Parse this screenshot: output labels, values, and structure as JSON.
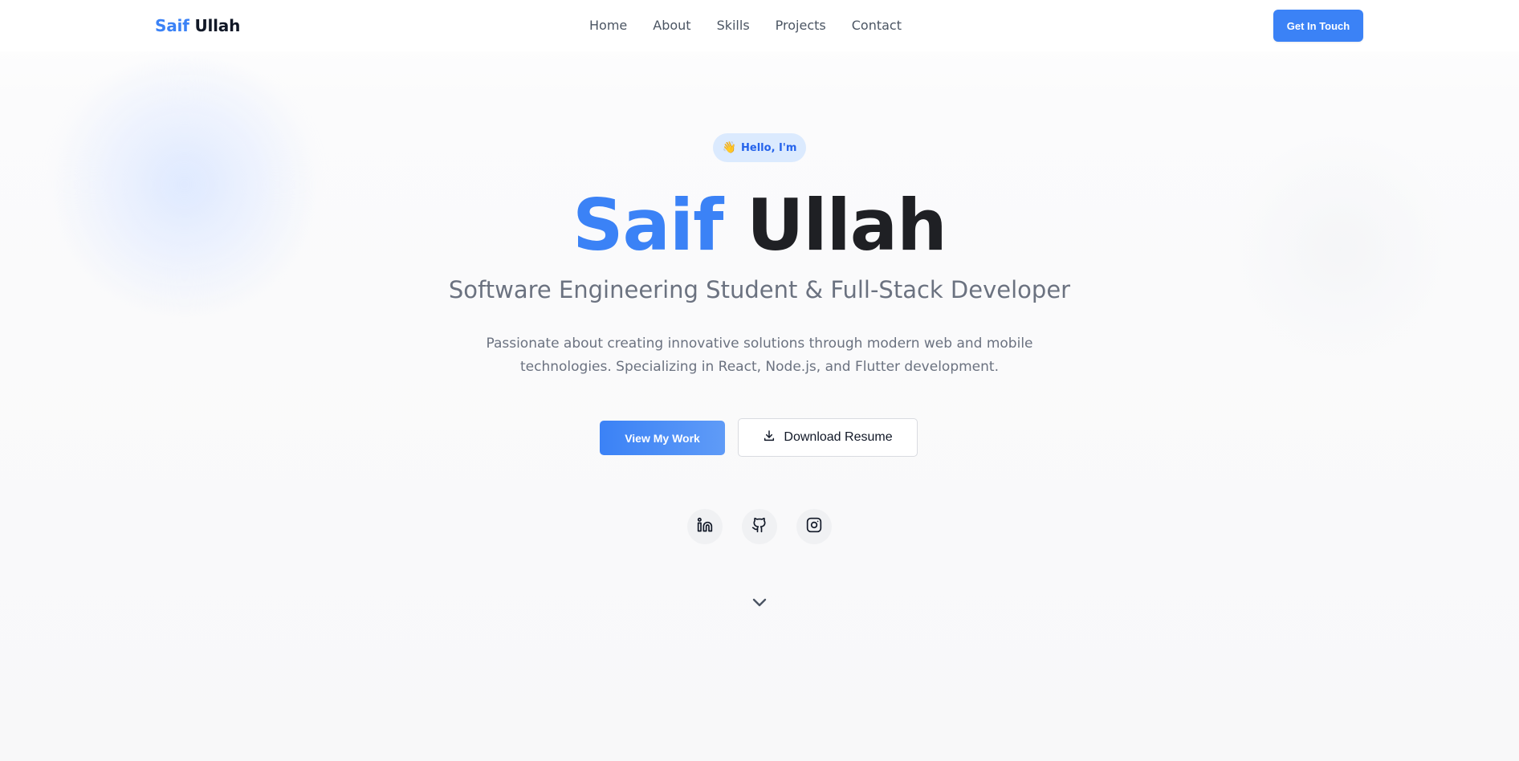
{
  "nav": {
    "brand_first": "Saif",
    "brand_last": "Ullah",
    "links": [
      "Home",
      "About",
      "Skills",
      "Projects",
      "Contact"
    ],
    "cta_label": "Get In Touch"
  },
  "hero": {
    "badge_emoji": "👋",
    "badge_text": "Hello, I'm",
    "title_first": "Saif",
    "title_last": "Ullah",
    "subtitle": "Software Engineering Student & Full-Stack Developer",
    "description": "Passionate about creating innovative solutions through modern web and mobile technologies. Specializing in React, Node.js, and Flutter development.",
    "primary_button": "View My Work",
    "secondary_button": "Download Resume",
    "secondary_button_icon": "download-icon",
    "socials": [
      "linkedin-icon",
      "github-icon",
      "instagram-icon"
    ],
    "scroll_icon": "chevron-down-icon"
  },
  "colors": {
    "accent": "#3b82f6",
    "text_dark": "#1f2024",
    "text_muted": "#6b7280",
    "badge_bg": "#dbeafe"
  }
}
